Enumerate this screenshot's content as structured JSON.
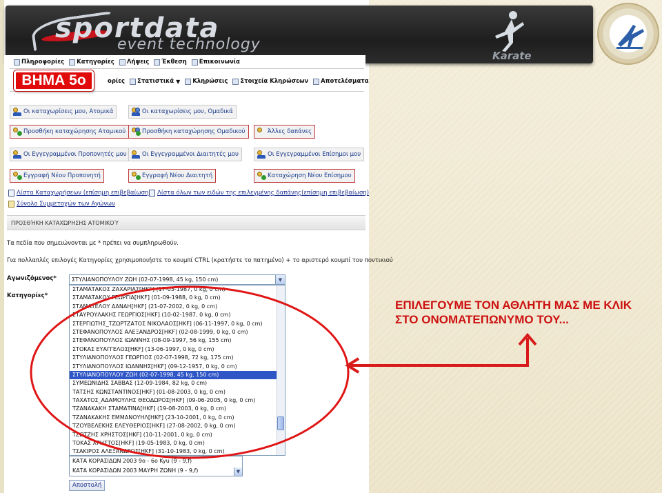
{
  "banner": {
    "brand_main": "sportdata",
    "brand_sub": "event technology",
    "sport_label": "Karate"
  },
  "step_badge": "ΒΗΜΑ 5ο",
  "menu_top": [
    {
      "label": "Πληροφορίες",
      "icon": "info-icon"
    },
    {
      "label": "Κατηγορίες",
      "icon": "categories-icon"
    },
    {
      "label": "Λήψεις",
      "icon": "download-icon"
    },
    {
      "label": "Έκθεση",
      "icon": "report-icon"
    },
    {
      "label": "Επικοινωνία",
      "icon": "contact-icon"
    }
  ],
  "menu_second": [
    {
      "label": "ορίες",
      "icon": "categories-icon"
    },
    {
      "label": "Στατιστικά",
      "icon": "stats-icon"
    },
    {
      "label": "Κληρώσεις",
      "icon": "draw-icon"
    },
    {
      "label": "Στοιχεία Κληρώσεων",
      "icon": "draw-data-icon"
    },
    {
      "label": "Αποτελέσματα",
      "icon": "results-icon"
    }
  ],
  "buttons": {
    "my_entries_individual": "Οι καταχωρίσεις μου, Ατομικά",
    "my_entries_team": "Οι καταχωρίσεις μου, Ομαδικά",
    "add_entry_individual": "Προσθήκη καταχώρησης Ατομικού",
    "add_entry_team": "Προσθήκη καταχώρησης Ομαδικού",
    "other_expenses": "Άλλες δαπάνες",
    "registered_coaches": "Οι Εγγεγραμμένοι Προπονητές μου",
    "registered_referees": "Οι Εγγεγραμμένοι Διαιτητές μου",
    "registered_officials": "Οι Εγγεγραμμένοι Επίσημοι μου",
    "new_coach": "Εγγραφή Νέου Προπονητή",
    "new_referee": "Εγγραφή Νέου Διαιτητή",
    "new_official": "Καταχώρηση Νέου Επίσημου"
  },
  "links": {
    "entries_list": "Λίστα Καταχωρήσεων (επίσημη επιβεβαίωση)",
    "expenses_list": "Λίστα όλων των ειδών της επιλεγμένης δαπάνης(επίσημη επιβεβαίωση)",
    "participants_total": "Σύνολο Συμμετοχών των Αγώνων"
  },
  "section_title": "ΠΡΟΣΘΉΚΗ ΚΑΤΑΧΏΡΗΣΗΣ ΑΤΟΜΙΚΟΎ",
  "notes": {
    "required": "Τα πεδία που σημειώνονται με * πρέπει να συμπληρωθούν.",
    "multi_select": "Για πολλαπλές επιλογές Κατηγορίες χρησιμοποιήστε το κουμπί CTRL (κρατήστε το πατημένο) + το αριστερό κουμπί του ποντικιού"
  },
  "form": {
    "athlete_label": "Αγωνιζόμενος*",
    "categories_label": "Κατηγορίες*",
    "athlete_selected": "ΣΤΥΛΙΑΝΟΠΟΥΛΟΥ ΖΩΗ (02-07-1998, 45 kg, 150 cm)",
    "athlete_options": [
      "ΣΤΑΜΑΤΑΚΟΣ ΖΑΧΑΡΙΑΣ[HKF] (17-03-1987, 0 kg, 0 cm)",
      "ΣΤΑΜΑΤΑΚΟΥ ΓΕΩΡΓΙΑ[HKF] (01-09-1988, 0 kg, 0 cm)",
      "ΣΤΑΜΑΤΕΛΟΥ ΔΑΝΑΗ[HKF] (21-07-2002, 0 kg, 0 cm)",
      "ΣΤΑΥΡΟΥΛΑΚΗΣ ΓΕΩΡΓΙΟΣ[HKF] (10-02-1987, 0 kg, 0 cm)",
      "ΣΤΕΡΓΙΩΤΗΣ_ΤΖΩΡΤΖΑΤΟΣ ΝΙΚΟΛΑΟΣ[HKF] (06-11-1997, 0 kg, 0 cm)",
      "ΣΤΕΦΑΝΟΠΟΥΛΟΣ ΑΛΕΞΑΝΔΡΟΣ[HKF] (02-08-1999, 0 kg, 0 cm)",
      "ΣΤΕΦΑΝΟΠΟΥΛΟΣ ΙΩΑΝΝΗΣ (08-09-1997, 56 kg, 155 cm)",
      "ΣΤΟΚΑΣ ΕΥΑΓΓΕΛΟΣ[HKF] (13-06-1997, 0 kg, 0 cm)",
      "ΣΤΥΛΙΑΝΟΠΟΥΛΟΣ ΓΕΩΡΓΙΟΣ (02-07-1998, 72 kg, 175 cm)",
      "ΣΤΥΛΙΑΝΟΠΟΥΛΟΣ ΙΩΑΝΝΗΣ[HKF] (09-12-1957, 0 kg, 0 cm)",
      "ΣΤΥΛΙΑΝΟΠΟΥΛΟΥ ΖΩΗ (02-07-1998, 45 kg, 150 cm)",
      "ΣΥΜΕΩΝΙΔΗΣ ΣΑΒΒΑΣ (12-09-1984, 82 kg, 0 cm)",
      "ΤΑΤΣΗΣ ΚΩΝΣΤΑΝΤΙΝΟΣ[HKF] (01-08-2003, 0 kg, 0 cm)",
      "ΤΑΧΑΤΟΣ_ΑΔΑΜΟΥΛΗΣ ΘΕΟΔΩΡΟΣ[HKF] (09-06-2005, 0 kg, 0 cm)",
      "ΤΖΑΝΑΚΑΚΗ ΣΤΑΜΑΤΙΝΑ[HKF] (19-08-2003, 0 kg, 0 cm)",
      "ΤΖΑΝΑΚΑΚΗΣ ΕΜΜΑΝΟΥΗΛ[HKF] (23-10-2001, 0 kg, 0 cm)",
      "ΤΖΟΥΒΕΛΕΚΗΣ ΕΛΕΥΘΕΡΙΟΣ[HKF] (27-08-2002, 0 kg, 0 cm)",
      "ΤΖΩΤΖΗΣ ΧΡΗΣΤΟΣ[HKF] (10-11-2001, 0 kg, 0 cm)",
      "ΤΟΚΑΣ ΧΡΗΣΤΟΣ[HKF] (19-05-1983, 0 kg, 0 cm)",
      "ΤΣΑΚΙΡΟΣ ΑΛΕΞΑΝΔΡΟΣ[HKF] (31-10-1983, 0 kg, 0 cm)"
    ],
    "selected_index": 10,
    "category_options": [
      "ΚΑΤΑ ΚΟΡΑΣΙΔΩΝ 2003 9ο - 6ο Kyu (9 - 9,f)",
      "ΚΑΤΑ ΚΟΡΑΣΙΔΩΝ 2003 ΜΑΥΡΗ ΖΩΝΗ (9 - 9,f)"
    ],
    "submit_label": "Αποστολή"
  },
  "callout_text": "ΕΠΙΛΕΓΟΥΜΕ ΤΟΝ ΑΘΛΗΤΗ ΜΑΣ ΜΕ ΚΛΙΚ ΣΤΟ ΟΝΟΜΑΤΕΠΩΝΥΜΟ ΤΟΥ...",
  "colors": {
    "accent_red": "#cc1111",
    "selection_blue": "#2f56c6",
    "link_blue": "#1b2f8f"
  }
}
